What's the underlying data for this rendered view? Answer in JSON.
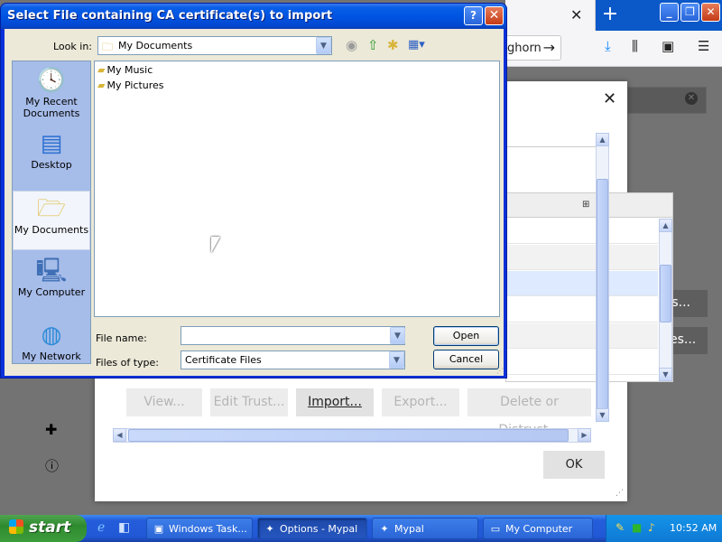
{
  "file_dialog": {
    "title": "Select File containing CA certificate(s) to import",
    "help_button": "?",
    "close_button": "✕",
    "look_in_label": "Look in:",
    "look_in_value": "My Documents",
    "places": [
      {
        "label": "My Recent Documents",
        "icon": "recent-documents-icon"
      },
      {
        "label": "Desktop",
        "icon": "desktop-icon"
      },
      {
        "label": "My Documents",
        "icon": "my-documents-icon",
        "selected": true
      },
      {
        "label": "My Computer",
        "icon": "my-computer-icon"
      },
      {
        "label": "My Network",
        "icon": "my-network-icon"
      }
    ],
    "files": [
      {
        "name": "My Music"
      },
      {
        "name": "My Pictures"
      }
    ],
    "file_name_label": "File name:",
    "file_name_value": "",
    "files_of_type_label": "Files of type:",
    "files_of_type_value": "Certificate Files",
    "open_button": "Open",
    "cancel_button": "Cancel"
  },
  "firefox": {
    "url_fragment": "ghorn",
    "new_tab": "+",
    "certificate_badge": "cert",
    "certificates_button": "rtificates...",
    "devices_button": "y Devices..."
  },
  "cert_manager": {
    "close": "✕",
    "buttons": {
      "view": "View...",
      "edit_trust": "Edit Trust...",
      "import": "Import...",
      "export": "Export...",
      "delete": "Delete or Distrust..."
    },
    "ok": "OK"
  },
  "taskbar": {
    "start": "start",
    "tasks": [
      {
        "label": "Windows Task..."
      },
      {
        "label": "Options - Mypal",
        "active": true
      },
      {
        "label": "Mypal"
      },
      {
        "label": "My Computer"
      }
    ],
    "clock": "10:52 AM"
  },
  "colors": {
    "xp_title_blue": "#0054e3",
    "dialog_face": "#ece9d8",
    "places_bar": "#a6bce9",
    "firefox_tab_blue": "#0b58c9",
    "cert_badge_yellow": "#ffe900",
    "taskbar_blue": "#245ddb",
    "start_green": "#3c9d3c"
  }
}
